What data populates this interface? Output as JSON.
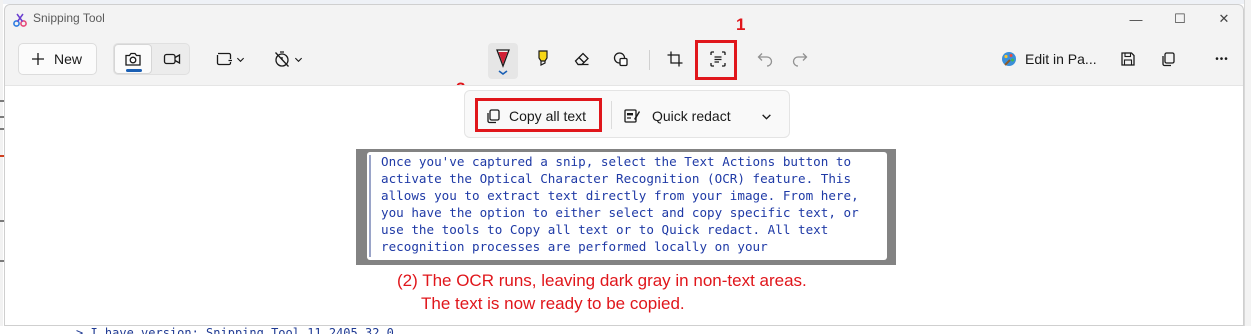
{
  "window": {
    "title": "Snipping Tool",
    "minimize_glyph": "—",
    "maximize_glyph": "☐",
    "close_glyph": "✕"
  },
  "background": {
    "bottom_text": "> I have version: Snipping Tool 11.2405.32.0"
  },
  "toolbar": {
    "new_label": "New",
    "edit_in_paint_label": "Edit in Pa...",
    "more_glyph": "•••"
  },
  "ocr_bar": {
    "copy_all_text_label": "Copy all text",
    "quick_redact_label": "Quick redact"
  },
  "snip_text_lines": [
    "Once you've captured a snip, select the Text Actions button to",
    "activate the Optical Character Recognition (OCR) feature. This",
    "allows you to extract text directly from your image. From here,",
    "you have the option to either select and copy specific text, or",
    "use the tools to Copy all text or to Quick redact. All text",
    "recognition processes are performed locally on your"
  ],
  "annotations": {
    "marker_1": "1",
    "marker_3": "3",
    "caption_line1": "(2) The OCR runs, leaving dark gray in non-text areas.",
    "caption_line2": "The text is now ready to be copied."
  },
  "colors": {
    "accent": "#1a5fb4",
    "annotation_red": "#e0161b",
    "ocr_text_blue": "#1f3aa6",
    "non_text_gray": "#838383"
  },
  "icons": [
    "snipping-tool-app-icon",
    "plus-icon",
    "camera-icon",
    "video-icon",
    "rectangle-mode-icon",
    "timer-off-icon",
    "ballpoint-pen-icon",
    "highlighter-icon",
    "eraser-icon",
    "shapes-icon",
    "crop-icon",
    "text-actions-icon",
    "undo-icon",
    "redo-icon",
    "paint-app-icon",
    "save-icon",
    "copy-icon",
    "more-icon",
    "copy-text-icon",
    "redact-icon",
    "chevron-down-icon"
  ]
}
